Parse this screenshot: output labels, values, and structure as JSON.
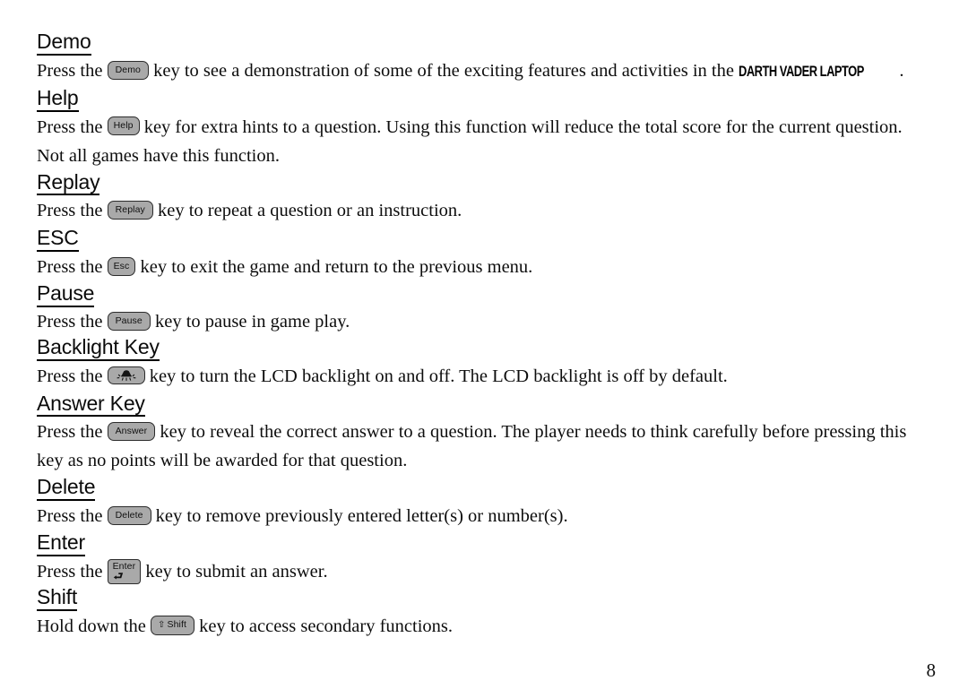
{
  "document": {
    "page_number": "8",
    "product_name": "DARTH VADER LAPTOP"
  },
  "sections": [
    {
      "id": "demo",
      "heading": "Demo",
      "key_label": "Demo",
      "key_type": "text",
      "text_before": "Press the ",
      "text_after": " key to see a demonstration of some of the exciting features and activities in the ",
      "brand": "DARTH VADER LAPTOP",
      "text_end": "."
    },
    {
      "id": "help",
      "heading": "Help",
      "key_label": "Help",
      "key_type": "text",
      "text_before": "Press the ",
      "text_after": " key for extra hints to a question. Using this function will reduce the total score for the current question. Not all games have this function."
    },
    {
      "id": "replay",
      "heading": "Replay",
      "key_label": "Replay",
      "key_type": "text",
      "text_before": "Press the ",
      "text_after": " key to repeat a question or an instruction."
    },
    {
      "id": "esc",
      "heading": "ESC",
      "key_label": "Esc",
      "key_type": "text",
      "text_before": "Press the ",
      "text_after": " key to exit the game and return to the previous menu."
    },
    {
      "id": "pause",
      "heading": "Pause",
      "key_label": "Pause",
      "key_type": "text",
      "text_before": "Press the ",
      "text_after": " key to pause in game play."
    },
    {
      "id": "backlight",
      "heading": "Backlight Key",
      "key_label": "",
      "key_type": "icon",
      "key_icon": "backlight-lamp-icon",
      "text_before": "Press the ",
      "text_after": " key to turn the LCD backlight on and off. The LCD backlight is off by default."
    },
    {
      "id": "answer",
      "heading": "Answer Key",
      "key_label": "Answer",
      "key_type": "text",
      "text_before": "Press the ",
      "text_after": " key to reveal the correct answer to a question. The player needs to think carefully before pressing this key as no points will be awarded for that question."
    },
    {
      "id": "delete",
      "heading": "Delete",
      "key_label": "Delete",
      "key_type": "text",
      "text_before": "Press the ",
      "text_after": " key to remove previously entered letter(s) or number(s)."
    },
    {
      "id": "enter",
      "heading": "Enter",
      "key_label": "Enter",
      "key_type": "enter",
      "key_glyph": "⮐",
      "text_before": "Press the ",
      "text_after": " key to submit an answer."
    },
    {
      "id": "shift",
      "heading": "Shift",
      "key_label": "Shift",
      "key_glyph": "⇧",
      "key_type": "shift",
      "text_before": "Hold down the ",
      "text_after": " key to access secondary functions."
    }
  ],
  "colors": {
    "key_fill": "#a9a9a9",
    "key_border": "#2c2c2c",
    "text": "#0d0d0d",
    "background": "#ffffff"
  }
}
